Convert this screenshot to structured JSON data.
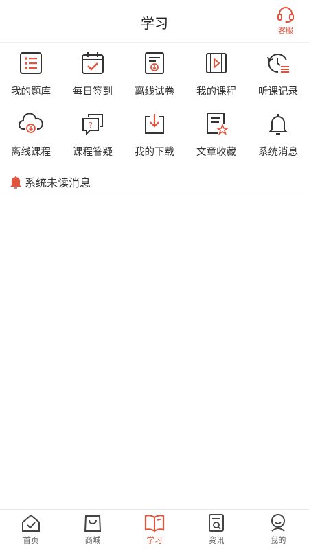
{
  "header": {
    "title": "学习",
    "service_label": "客服"
  },
  "grid": {
    "items": [
      {
        "label": "我的题库",
        "icon": "question-bank-icon"
      },
      {
        "label": "每日签到",
        "icon": "calendar-check-icon"
      },
      {
        "label": "离线试卷",
        "icon": "offline-paper-icon"
      },
      {
        "label": "我的课程",
        "icon": "video-course-icon"
      },
      {
        "label": "听课记录",
        "icon": "history-icon"
      },
      {
        "label": "离线课程",
        "icon": "cloud-download-icon"
      },
      {
        "label": "课程答疑",
        "icon": "question-chat-icon"
      },
      {
        "label": "我的下载",
        "icon": "download-icon"
      },
      {
        "label": "文章收藏",
        "icon": "article-star-icon"
      },
      {
        "label": "系统消息",
        "icon": "bell-icon"
      }
    ]
  },
  "notice": {
    "label": "系统未读消息"
  },
  "tabbar": {
    "items": [
      {
        "label": "首页",
        "icon": "home-icon"
      },
      {
        "label": "商城",
        "icon": "shop-bag-icon"
      },
      {
        "label": "学习",
        "icon": "book-icon",
        "active": true
      },
      {
        "label": "资讯",
        "icon": "news-icon"
      },
      {
        "label": "我的",
        "icon": "profile-icon"
      }
    ]
  },
  "colors": {
    "accent": "#e0533d",
    "icon_dark": "#333333",
    "divider": "#eeeeee"
  }
}
